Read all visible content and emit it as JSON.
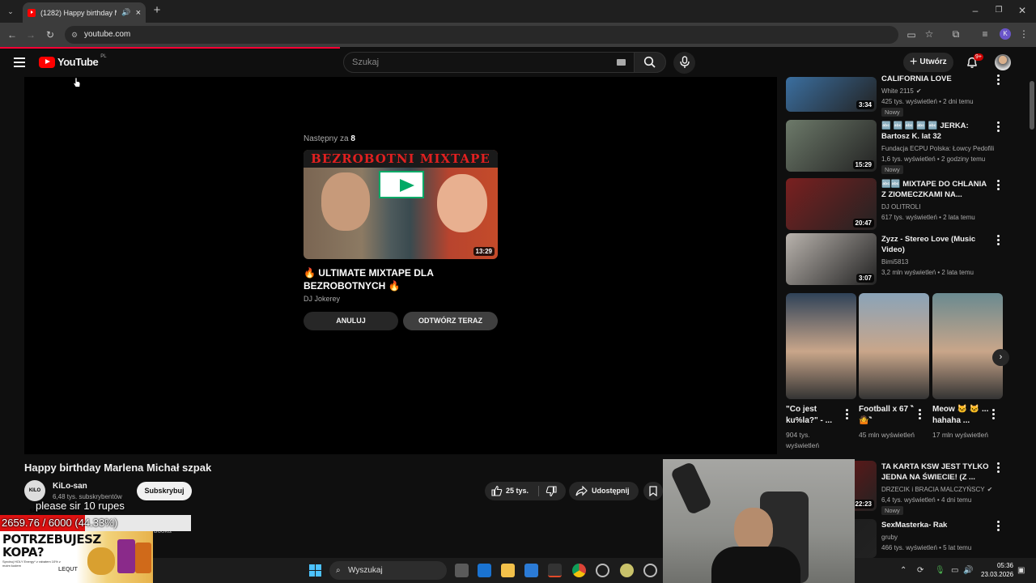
{
  "browser": {
    "tab_title": "(1282) Happy birthday Mar",
    "url": "youtube.com",
    "new_tab": "+"
  },
  "header": {
    "logo_text": "YouTube",
    "country_code": "PL",
    "search_placeholder": "Szukaj",
    "create_label": "Utwórz",
    "notifications_badge": "9+"
  },
  "upnext": {
    "label": "Następny za",
    "countdown": "8",
    "thumb_banner": "BEZROBOTNI MIXTAPE",
    "duration": "13:29",
    "title": "🔥 ULTIMATE MIXTAPE DLA BEZROBOTNYCH 🔥",
    "channel": "DJ Jokerey",
    "cancel_label": "ANULUJ",
    "play_now_label": "ODTWÓRZ TERAZ"
  },
  "video": {
    "title": "Happy birthday Marlena Michał szpak",
    "channel_name": "KiLo-san",
    "channel_avatar_text": "KILO SAN",
    "subscribers": "6,48 tys. subskrybentów",
    "subscribe_label": "Subskrybuj",
    "likes": "25 tys.",
    "share_label": "Udostępnij",
    "description_peek": "booka"
  },
  "overlay": {
    "donation_message": "please sir 10 rupes",
    "goal_text": "2659.76 / 6000 (44.33%)",
    "goal_fraction": 0.4433,
    "ad_headline_1": "POTRZEBUJESZ",
    "ad_headline_2": "KOPA?",
    "ad_small": "Sprobuj HOLY Energy* z rabatem 10% z moim kodem",
    "ad_code": "LEQUT"
  },
  "sidebar": {
    "items": [
      {
        "title": "CALIFORNIA LOVE",
        "channel": "White 2115",
        "verified": true,
        "meta": "425 tys. wyświetleń • 2 dni temu",
        "badge": "Nowy",
        "duration": "3:34",
        "thumb_color": "#3b6fa0"
      },
      {
        "title": "🔤 🔤 🔤 🔤 🔤 JERKA: Bartosz K. lat 32",
        "channel": "Fundacja ECPU Polska: Łowcy Pedofili",
        "verified": false,
        "meta": "1,6 tys. wyświetleń • 2 godziny temu",
        "badge": "Nowy",
        "duration": "15:29",
        "thumb_color": "#6d7a6a"
      },
      {
        "title": "🔤🔤 MIXTAPE DO CHLANIA Z ZIOMECZKAMI NA...",
        "channel": "DJ OLITROLI",
        "verified": false,
        "meta": "617 tys. wyświetleń • 2 lata temu",
        "badge": "",
        "duration": "20:47",
        "thumb_color": "#7a2020"
      },
      {
        "title": "Zyzz - Stereo Love (Music Video)",
        "channel": "Bimi5813",
        "verified": false,
        "meta": "3,2 mln wyświetleń • 2 lata temu",
        "badge": "",
        "duration": "3:07",
        "thumb_color": "#b9b3ad"
      }
    ],
    "shorts": [
      {
        "title": "\"Co jest ku%la?\" - ...",
        "views": "904 tys. wyświetleń",
        "color": "#2f4258"
      },
      {
        "title": "Football x 67 ‶🤷‶",
        "views": "45 mln wyświetleń",
        "color": "#8aa3b8"
      },
      {
        "title": "Meow 🐱 🐱 ... hahaha ...",
        "views": "17 mln wyświetleń",
        "color": "#6a8a90"
      }
    ],
    "lower_items": [
      {
        "title": "TA KARTA KSW JEST TYLKO JEDNA NA ŚWIECIE! (Z ...",
        "channel": "DRZECIK i BRACIA MALCZYŃSCY",
        "verified": true,
        "meta": "6,4 tys. wyświetleń • 4 dni temu",
        "badge": "Nowy",
        "duration": "22:23",
        "thumb_color": "#8a1010"
      },
      {
        "title": "SexMasterka- Rak",
        "channel": "gruby",
        "verified": false,
        "meta": "466 tys. wyświetleń • 5 lat temu",
        "badge": "",
        "duration": "",
        "thumb_color": "#1a1a1a"
      }
    ]
  },
  "taskbar": {
    "search_label": "Wyszukaj",
    "time": "05:36",
    "date": "23.03.2026"
  }
}
